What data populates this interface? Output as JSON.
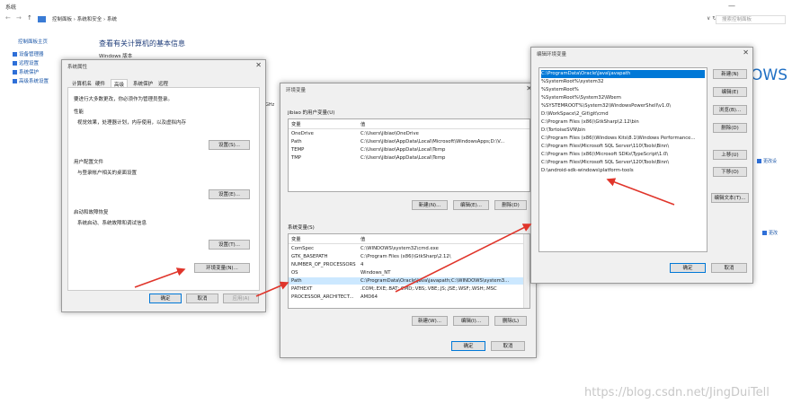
{
  "window": {
    "title": "系统",
    "address": [
      "控制面板",
      "系统和安全",
      "系统"
    ],
    "search_placeholder": "搜索控制面板",
    "nav": {
      "back": "←",
      "forward": "→",
      "up": "↑"
    },
    "refresh": "∨ ↻",
    "minimize": "—"
  },
  "sidebar": {
    "home": "控制面板主页",
    "items": [
      {
        "label": "设备管理器"
      },
      {
        "label": "远程设置"
      },
      {
        "label": "系统保护"
      },
      {
        "label": "高级系统设置"
      }
    ]
  },
  "main": {
    "heading": "查看有关计算机的基本信息",
    "edition": "Windows 版本",
    "big_text": "OWS",
    "ghz": "GHz",
    "change_link": "更改设",
    "change_link2": "更改"
  },
  "system_properties": {
    "title": "系统属性",
    "close": "✕",
    "tabs": [
      "计算机名",
      "硬件",
      "高级",
      "系统保护",
      "远程"
    ],
    "active_tab": "高级",
    "admin_note": "要进行大多数更改，你必须作为管理员登录。",
    "performance": {
      "title": "性能",
      "desc": "视觉效果，处理器计划，内存使用，以及虚拟内存",
      "button": "设置(S)..."
    },
    "user_profiles": {
      "title": "用户配置文件",
      "desc": "与登录帐户相关的桌面设置",
      "button": "设置(E)..."
    },
    "startup": {
      "title": "启动和故障恢复",
      "desc": "系统启动、系统故障和调试信息",
      "button": "设置(T)..."
    },
    "env_button": "环境变量(N)...",
    "ok": "确定",
    "cancel": "取消",
    "apply": "应用(A)"
  },
  "env_vars": {
    "title": "环境变量",
    "close": "✕",
    "user_section": "jibiao 的用户变量(U)",
    "col_var": "变量",
    "col_val": "值",
    "user_vars": [
      {
        "name": "OneDrive",
        "value": "C:\\Users\\jibiao\\OneDrive"
      },
      {
        "name": "Path",
        "value": "C:\\Users\\jibiao\\AppData\\Local\\Microsoft\\WindowsApps;D:\\V..."
      },
      {
        "name": "TEMP",
        "value": "C:\\Users\\jibiao\\AppData\\Local\\Temp"
      },
      {
        "name": "TMP",
        "value": "C:\\Users\\jibiao\\AppData\\Local\\Temp"
      }
    ],
    "user_buttons": [
      "新建(N)...",
      "编辑(E)...",
      "删除(D)"
    ],
    "sys_section": "系统变量(S)",
    "sys_vars": [
      {
        "name": "ComSpec",
        "value": "C:\\WINDOWS\\system32\\cmd.exe"
      },
      {
        "name": "GTK_BASEPATH",
        "value": "C:\\Program Files (x86)\\GtkSharp\\2.12\\"
      },
      {
        "name": "NUMBER_OF_PROCESSORS",
        "value": "4"
      },
      {
        "name": "OS",
        "value": "Windows_NT"
      },
      {
        "name": "Path",
        "value": "C:\\ProgramData\\Oracle\\Java\\javapath;C:\\WINDOWS\\system3..."
      },
      {
        "name": "PATHEXT",
        "value": ".COM;.EXE;.BAT;.CMD;.VBS;.VBE;.JS;.JSE;.WSF;.WSH;.MSC"
      },
      {
        "name": "PROCESSOR_ARCHITECT...",
        "value": "AMD64"
      }
    ],
    "sys_selected": 4,
    "sys_buttons": [
      "新建(W)...",
      "编辑(I)...",
      "删除(L)"
    ],
    "ok": "确定",
    "cancel": "取消"
  },
  "edit_env": {
    "title": "编辑环境变量",
    "close": "✕",
    "entries": [
      "C:\\ProgramData\\Oracle\\Java\\javapath",
      "%SystemRoot%\\system32",
      "%SystemRoot%",
      "%SystemRoot%\\System32\\Wbem",
      "%SYSTEMROOT%\\System32\\WindowsPowerShell\\v1.0\\",
      "D:\\WorkSpace\\2_Git\\git\\cmd",
      "C:\\Program Files (x86)\\GtkSharp\\2.12\\bin",
      "D:\\TortoiseSVN\\bin",
      "C:\\Program Files (x86)\\Windows Kits\\8.1\\Windows Performance...",
      "C:\\Program Files\\Microsoft SQL Server\\110\\Tools\\Binn\\",
      "C:\\Program Files (x86)\\Microsoft SDKs\\TypeScript\\1.0\\",
      "C:\\Program Files\\Microsoft SQL Server\\120\\Tools\\Binn\\",
      "D:\\android-sdk-windows\\platform-tools"
    ],
    "selected": 0,
    "buttons": [
      "新建(N)",
      "编辑(E)",
      "浏览(B)...",
      "删除(D)",
      "上移(U)",
      "下移(O)",
      "编辑文本(T)..."
    ],
    "ok": "确定",
    "cancel": "取消"
  },
  "watermark": "https://blog.csdn.net/JingDuiTell",
  "colors": {
    "arrow": "#e0352b",
    "accent": "#0078d7",
    "link": "#1a56a8"
  }
}
